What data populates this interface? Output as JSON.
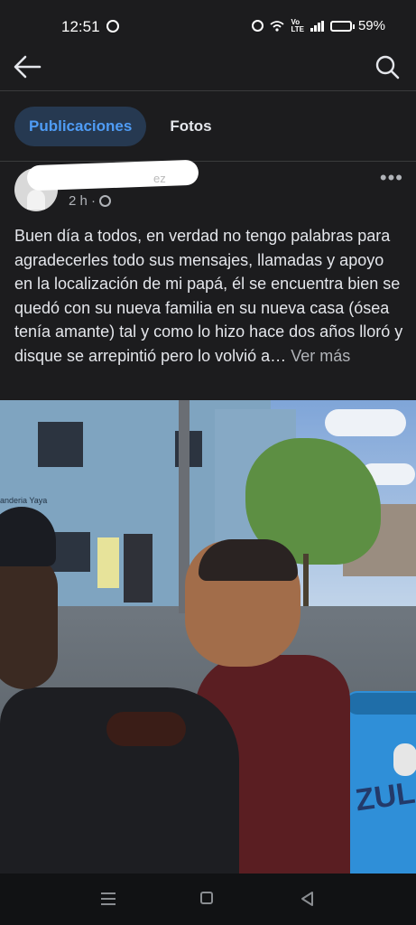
{
  "status_bar": {
    "time": "12:51",
    "battery": "59%",
    "battery_level": 0.59,
    "network_label_top": "Vo",
    "network_label_bottom": "LTE",
    "icons": [
      "whatsapp-icon",
      "alarm-icon",
      "wifi-icon",
      "signal-icon",
      "battery-icon"
    ]
  },
  "nav": {
    "icons": [
      "back-arrow-icon",
      "search-icon"
    ]
  },
  "tabs": [
    {
      "label": "Publicaciones",
      "active": true
    },
    {
      "label": "Fotos",
      "active": false
    }
  ],
  "post": {
    "author_suffix": "ez",
    "time_ago": "2 h ·",
    "body": "Buen día a todos, en verdad no tengo palabras para agradecerles todo sus mensajes, llamadas y apoyo en la localización de mi papá, él se encuentra bien se quedó con su nueva familia en su nueva casa (ósea tenía amante) tal y como lo hizo hace dos años lloró y disque se arrepintió pero lo volvió a…",
    "see_more": "Ver más",
    "photo": {
      "shop_sign": "anderia Yaya",
      "barrel_text": "ZUL"
    }
  },
  "colors": {
    "background": "#1c1c1e",
    "tab_active_bg": "#263951",
    "tab_active_text": "#4f9cf5",
    "text_secondary": "#b0b3b8"
  }
}
